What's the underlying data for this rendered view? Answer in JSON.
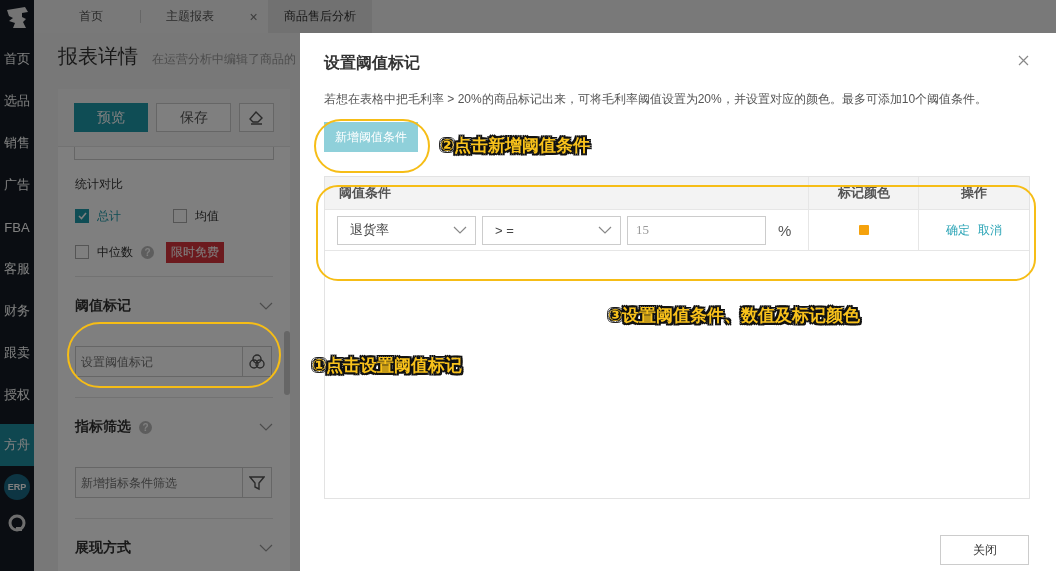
{
  "nav": {
    "items": [
      {
        "label": "首页",
        "selected": false
      },
      {
        "label": "选品",
        "selected": false
      },
      {
        "label": "销售",
        "selected": false
      },
      {
        "label": "广告",
        "selected": false
      },
      {
        "label": "FBA",
        "selected": false
      },
      {
        "label": "客服",
        "selected": false
      },
      {
        "label": "财务",
        "selected": false
      },
      {
        "label": "跟卖",
        "selected": false
      },
      {
        "label": "授权",
        "selected": false
      },
      {
        "label": "方舟",
        "selected": true
      }
    ],
    "badge": "ERP"
  },
  "tabs": [
    {
      "label": "首页",
      "selected": false
    },
    {
      "label": "主题报表",
      "selected": false,
      "close": "×"
    },
    {
      "label": "商品售后分析",
      "selected": true
    }
  ],
  "page": {
    "title": "报表详情",
    "subtitle": "在运营分析中编辑了商品的"
  },
  "panel": {
    "buttons": [
      {
        "kind": "primary",
        "label": "预览"
      },
      {
        "kind": "default",
        "label": "保存"
      },
      {
        "kind": "eraser"
      }
    ],
    "compare": {
      "title": "统计对比",
      "options": [
        {
          "label": "总计",
          "checked": true
        },
        {
          "label": "均值",
          "checked": false
        },
        {
          "label": "中位数",
          "checked": false,
          "help": "?",
          "badge": "限时免费"
        }
      ]
    },
    "sections": [
      {
        "title": "阈值标记",
        "field": {
          "placeholder": "设置阈值标记"
        }
      },
      {
        "title": "指标筛选",
        "help": "?",
        "field": {
          "placeholder": "新增指标条件筛选"
        }
      },
      {
        "title": "展现方式"
      }
    ]
  },
  "dialog": {
    "title": "设置阈值标记",
    "description": "若想在表格中把毛利率 > 20%的商品标记出来，可将毛利率阈值设置为20%，并设置对应的颜色。最多可添加10个阈值条件。",
    "add_button": "新增阈值条件",
    "columns": [
      "阈值条件",
      "标记颜色",
      "操作"
    ],
    "rows": [
      {
        "metric": "退货率",
        "operator": "> =",
        "value": "15",
        "unit": "%",
        "color": "#f5a20c",
        "actions": [
          "确定",
          "取消"
        ]
      }
    ],
    "close_button": "关闭"
  },
  "annotations": [
    {
      "text": "①点击设置阈值标记"
    },
    {
      "text": "②点击新增阈值条件"
    },
    {
      "text": "③设置阈值条件、数值及标记颜色"
    }
  ]
}
